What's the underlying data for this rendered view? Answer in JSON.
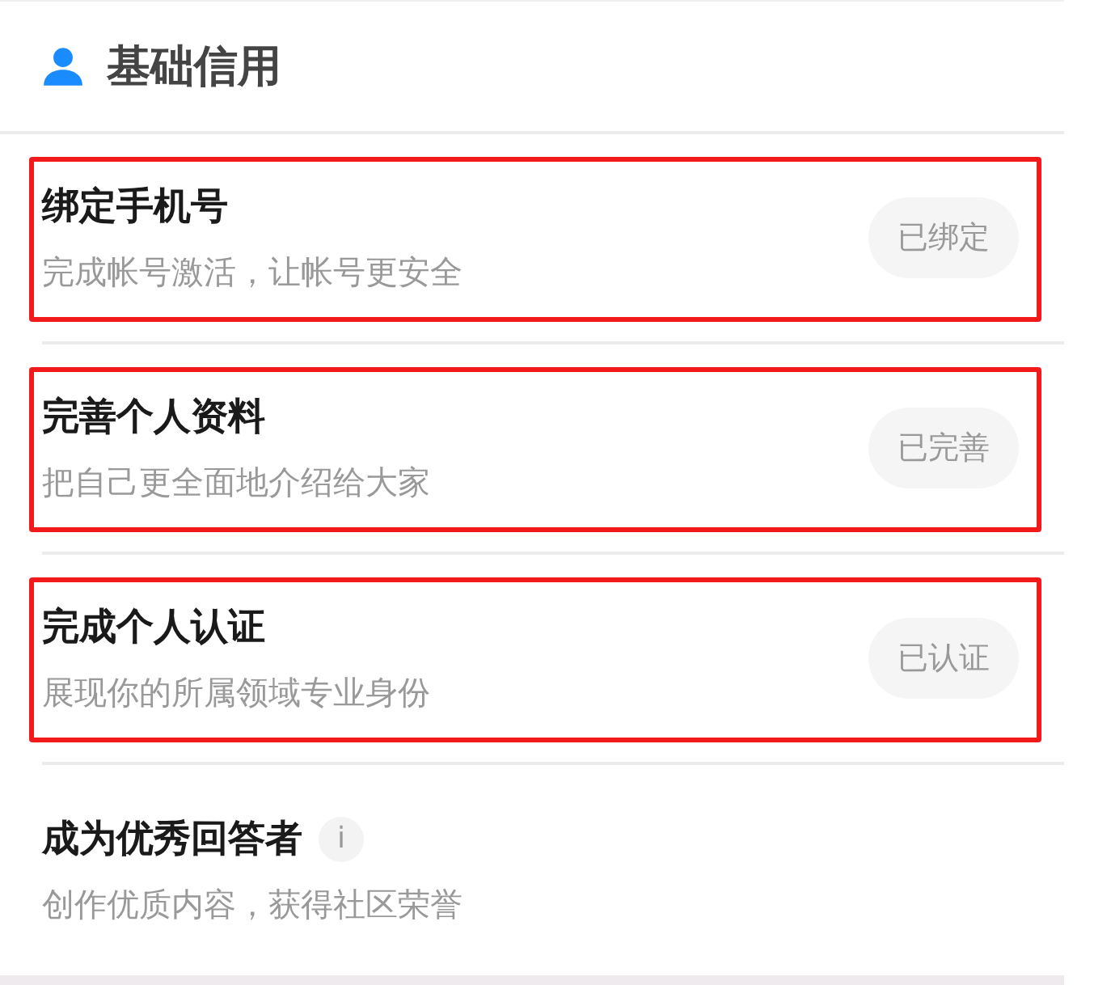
{
  "section": {
    "title": "基础信用"
  },
  "items": [
    {
      "title": "绑定手机号",
      "subtitle": "完成帐号激活，让帐号更安全",
      "status": "已绑定",
      "highlighted": true
    },
    {
      "title": "完善个人资料",
      "subtitle": "把自己更全面地介绍给大家",
      "status": "已完善",
      "highlighted": true
    },
    {
      "title": "完成个人认证",
      "subtitle": "展现你的所属领域专业身份",
      "status": "已认证",
      "highlighted": true
    },
    {
      "title": "成为优秀回答者",
      "info": "i",
      "subtitle": "创作优质内容，获得社区荣誉",
      "highlighted": false
    }
  ]
}
